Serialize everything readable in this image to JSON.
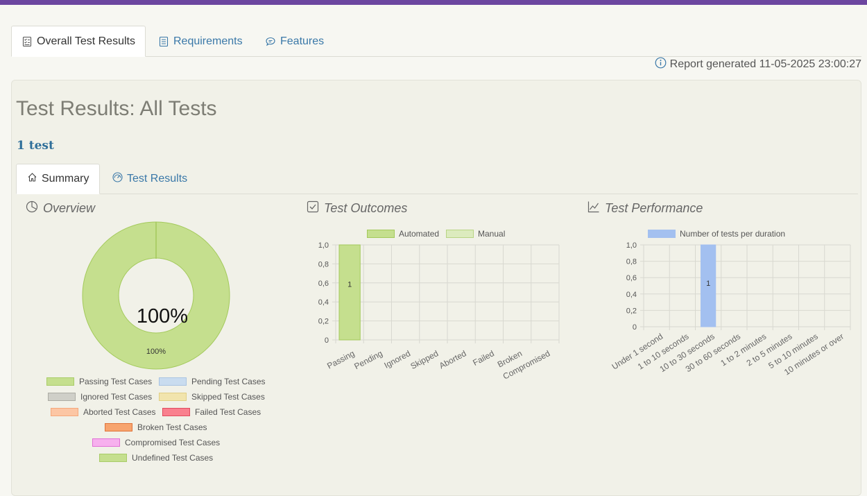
{
  "tabs": [
    {
      "label": "Overall Test Results",
      "active": true
    },
    {
      "label": "Requirements",
      "active": false
    },
    {
      "label": "Features",
      "active": false
    }
  ],
  "report_generated": "Report generated 11-05-2025 23:00:27",
  "page_title": "Test Results: All Tests",
  "test_count": "1 test",
  "sub_tabs": [
    {
      "label": "Summary",
      "active": true
    },
    {
      "label": "Test Results",
      "active": false
    }
  ],
  "colors": {
    "top_bar": "#6c46a0",
    "link": "#3a78a8",
    "passing": "#c5df8e",
    "passing_border": "#a3c95b",
    "duration_bar": "#a3c0f0"
  },
  "overview": {
    "heading": "Overview",
    "center_label": "100%",
    "slice_label": "100%",
    "legend": [
      {
        "label": "Passing Test Cases",
        "color": "#c5df8e",
        "border": "#a9cc68"
      },
      {
        "label": "Pending Test Cases",
        "color": "#c9dcef",
        "border": "#a9c4e2"
      },
      {
        "label": "Ignored Test Cases",
        "color": "#cfcfc8",
        "border": "#acaca4"
      },
      {
        "label": "Skipped Test Cases",
        "color": "#f1e4ad",
        "border": "#e1cf84"
      },
      {
        "label": "Aborted Test Cases",
        "color": "#fcc6a4",
        "border": "#f5a77a"
      },
      {
        "label": "Failed Test Cases",
        "color": "#f9808e",
        "border": "#e04b5e"
      },
      {
        "label": "Broken Test Cases",
        "color": "#f7a46e",
        "border": "#e0733a"
      },
      {
        "label": "Compromised Test Cases",
        "color": "#f7b0ee",
        "border": "#e070d5"
      },
      {
        "label": "Undefined Test Cases",
        "color": "#c5df8e",
        "border": "#a9cc68"
      }
    ]
  },
  "outcomes": {
    "heading": "Test Outcomes",
    "legend": [
      {
        "label": "Automated",
        "color": "#c5df8e",
        "border": "#a3c95b"
      },
      {
        "label": "Manual",
        "color": "#dcebbe",
        "border": "#b8d484"
      }
    ]
  },
  "performance": {
    "heading": "Test Performance",
    "legend_label": "Number of tests per duration"
  },
  "chart_data": [
    {
      "type": "pie",
      "categories": [
        "Passing Test Cases",
        "Pending Test Cases",
        "Ignored Test Cases",
        "Skipped Test Cases",
        "Aborted Test Cases",
        "Failed Test Cases",
        "Broken Test Cases",
        "Compromised Test Cases",
        "Undefined Test Cases"
      ],
      "values": [
        1,
        0,
        0,
        0,
        0,
        0,
        0,
        0,
        0
      ],
      "labels": [
        "100%"
      ],
      "donut": true
    },
    {
      "type": "bar",
      "stacked": true,
      "categories": [
        "Passing",
        "Pending",
        "Ignored",
        "Skipped",
        "Aborted",
        "Failed",
        "Broken",
        "Compromised"
      ],
      "series": [
        {
          "name": "Automated",
          "values": [
            1,
            0,
            0,
            0,
            0,
            0,
            0,
            0
          ]
        },
        {
          "name": "Manual",
          "values": [
            0,
            0,
            0,
            0,
            0,
            0,
            0,
            0
          ]
        }
      ],
      "yticks": [
        "0",
        "0,2",
        "0,4",
        "0,6",
        "0,8",
        "1,0"
      ],
      "ylim": [
        0,
        1
      ],
      "grid": true,
      "legend": "top"
    },
    {
      "type": "bar",
      "categories": [
        "Under 1 second",
        "1 to 10 seconds",
        "10 to 30 seconds",
        "30 to 60 seconds",
        "1 to 2 minutes",
        "2 to 5 minutes",
        "5 to 10 minutes",
        "10 minutes or over"
      ],
      "series": [
        {
          "name": "Number of tests per duration",
          "values": [
            0,
            0,
            1,
            0,
            0,
            0,
            0,
            0
          ]
        }
      ],
      "yticks": [
        "0",
        "0,2",
        "0,4",
        "0,6",
        "0,8",
        "1,0"
      ],
      "ylim": [
        0,
        1
      ],
      "grid": true,
      "legend": "top"
    }
  ]
}
